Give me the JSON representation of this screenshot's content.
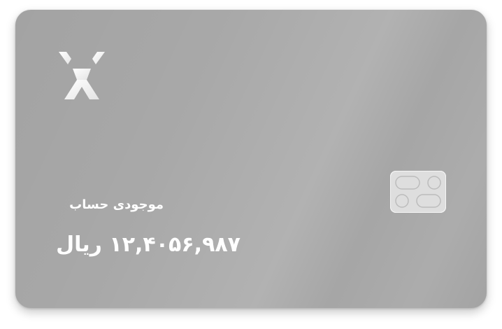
{
  "card": {
    "brand_icon": "x-logo-icon",
    "chip_icon": "card-chip-icon",
    "balance_label": "موجودی حساب",
    "balance_amount": "۱۲,۴۰۵۶,۹۸۷ ریال"
  }
}
